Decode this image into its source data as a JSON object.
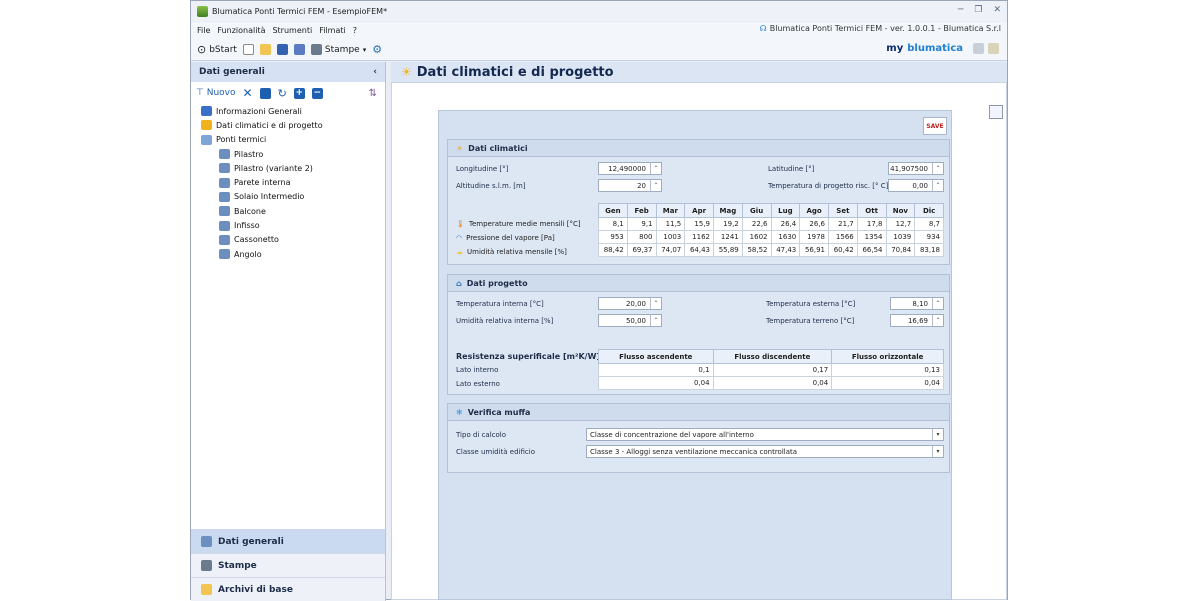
{
  "window": {
    "title": "Blumatica Ponti Termici FEM - EsempioFEM*",
    "controls": [
      "─",
      "❐",
      "✕"
    ]
  },
  "menu": {
    "items": [
      "File",
      "Funzionalità",
      "Strumenti",
      "Filmati",
      "?"
    ],
    "version": "Blumatica Ponti Termici FEM - ver. 1.0.0.1 - Blumatica S.r.l"
  },
  "toolbar": {
    "bstart": "bStart",
    "stampe": "Stampe",
    "logo_my": "my",
    "logo_blu": "blumatica"
  },
  "left": {
    "header": "Dati generali",
    "collapse": "‹",
    "nuovo": "Nuovo",
    "tree": [
      {
        "label": "Informazioni Generali",
        "level": 1,
        "color": "#3a6fc7"
      },
      {
        "label": "Dati climatici e di progetto",
        "level": 1,
        "color": "#f0b31e"
      },
      {
        "label": "Ponti termici",
        "level": 1,
        "color": "#7fa4d6"
      },
      {
        "label": "Pilastro",
        "level": 2,
        "color": "#6d8fc0"
      },
      {
        "label": "Pilastro (variante 2)",
        "level": 2,
        "color": "#6d8fc0"
      },
      {
        "label": "Parete interna",
        "level": 2,
        "color": "#6d8fc0"
      },
      {
        "label": "Solaio Intermedio",
        "level": 2,
        "color": "#6d8fc0"
      },
      {
        "label": "Balcone",
        "level": 2,
        "color": "#6d8fc0"
      },
      {
        "label": "Infisso",
        "level": 2,
        "color": "#6d8fc0"
      },
      {
        "label": "Cassonetto",
        "level": 2,
        "color": "#6d8fc0"
      },
      {
        "label": "Angolo",
        "level": 2,
        "color": "#6d8fc0"
      }
    ],
    "nav": [
      "Dati generali",
      "Stampe",
      "Archivi di base"
    ]
  },
  "content": {
    "title": "Dati climatici e di progetto",
    "save": "SAVE",
    "climatici": {
      "title": "Dati climatici",
      "longitudine_label": "Longitudine [°]",
      "longitudine": "12,490000",
      "latitudine_label": "Latitudine [°]",
      "latitudine": "41,907500",
      "altitudine_label": "Altitudine s.l.m. [m]",
      "altitudine": "20",
      "temp_prog_label": "Temperatura di progetto risc. [° C]",
      "temp_prog": "0,00",
      "months": [
        "Gen",
        "Feb",
        "Mar",
        "Apr",
        "Mag",
        "Giu",
        "Lug",
        "Ago",
        "Set",
        "Ott",
        "Nov",
        "Dic"
      ],
      "rows": [
        {
          "label": "Temperature medie mensili [°C]",
          "values": [
            "8,1",
            "9,1",
            "11,5",
            "15,9",
            "19,2",
            "22,6",
            "26,4",
            "26,6",
            "21,7",
            "17,8",
            "12,7",
            "8,7"
          ]
        },
        {
          "label": "Pressione del vapore [Pa]",
          "values": [
            "953",
            "800",
            "1003",
            "1162",
            "1241",
            "1602",
            "1630",
            "1978",
            "1566",
            "1354",
            "1039",
            "934"
          ]
        },
        {
          "label": "Umidità relativa mensile [%]",
          "values": [
            "88,42",
            "69,37",
            "74,07",
            "64,43",
            "55,89",
            "58,52",
            "47,43",
            "56,91",
            "60,42",
            "66,54",
            "70,84",
            "83,18"
          ]
        }
      ]
    },
    "progetto": {
      "title": "Dati progetto",
      "t_int_label": "Temperatura interna [°C]",
      "t_int": "20,00",
      "u_int_label": "Umidità relativa interna [%]",
      "u_int": "50,00",
      "t_est_label": "Temperatura esterna [°C]",
      "t_est": "8,10",
      "t_ter_label": "Temperatura terreno [°C]",
      "t_ter": "16,69",
      "res_label": "Resistenza superificale [m²K/W]",
      "res_cols": [
        "Flusso ascendente",
        "Flusso discendente",
        "Flusso orizzontale"
      ],
      "res_rows": [
        {
          "label": "Lato interno",
          "values": [
            "0,1",
            "0,17",
            "0,13"
          ]
        },
        {
          "label": "Lato esterno",
          "values": [
            "0,04",
            "0,04",
            "0,04"
          ]
        }
      ]
    },
    "muffa": {
      "title": "Verifica muffa",
      "tipo_label": "Tipo di calcolo",
      "tipo": "Classe di concentrazione del vapore all'interno",
      "classe_label": "Classe umidità edificio",
      "classe": "Classe 3 - Alloggi senza ventilazione meccanica controllata"
    }
  }
}
